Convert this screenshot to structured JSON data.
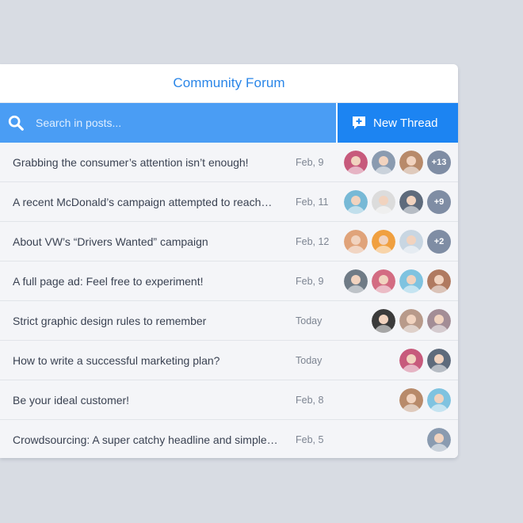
{
  "header": {
    "title": "Community Forum"
  },
  "search": {
    "placeholder": "Search in posts..."
  },
  "actions": {
    "new_thread_label": "New Thread"
  },
  "colors": {
    "accent": "#2a86e8",
    "search_bg": "#4a9df4",
    "button_bg": "#1c84f2"
  },
  "threads": [
    {
      "title": "Grabbing the consumer’s attention isn’t enough!",
      "date": "Feb, 9",
      "avatars": [
        "#c75a7c",
        "#8a9bb0",
        "#b88a6a"
      ],
      "extra": "+13"
    },
    {
      "title": "A recent McDonald’s campaign attempted to reach…",
      "date": "Feb, 11",
      "avatars": [
        "#77b9d6",
        "#dcdcdc",
        "#5e6b7c"
      ],
      "extra": "+9"
    },
    {
      "title": "About VW’s “Drivers Wanted” campaign",
      "date": "Feb, 12",
      "avatars": [
        "#e0a37a",
        "#f0a040",
        "#c8d6e2"
      ],
      "extra": "+2"
    },
    {
      "title": "A full page ad: Feel free to experiment!",
      "date": "Feb, 9",
      "avatars": [
        "#6f7b86",
        "#d36c82",
        "#7fc3e0",
        "#b07a60"
      ],
      "extra": ""
    },
    {
      "title": "Strict graphic design rules to remember",
      "date": "Today",
      "avatars": [
        "#3b3b3b",
        "#b89a8a",
        "#a38d96"
      ],
      "extra": ""
    },
    {
      "title": "How to write a successful marketing plan?",
      "date": "Today",
      "avatars": [
        "#c75a7c",
        "#5e6b7c"
      ],
      "extra": ""
    },
    {
      "title": "Be your ideal customer!",
      "date": "Feb, 8",
      "avatars": [
        "#b88a6a",
        "#7fc3e0"
      ],
      "extra": ""
    },
    {
      "title": "Crowdsourcing: A super catchy headline and simple…",
      "date": "Feb, 5",
      "avatars": [
        "#8a9bb0"
      ],
      "extra": ""
    }
  ]
}
